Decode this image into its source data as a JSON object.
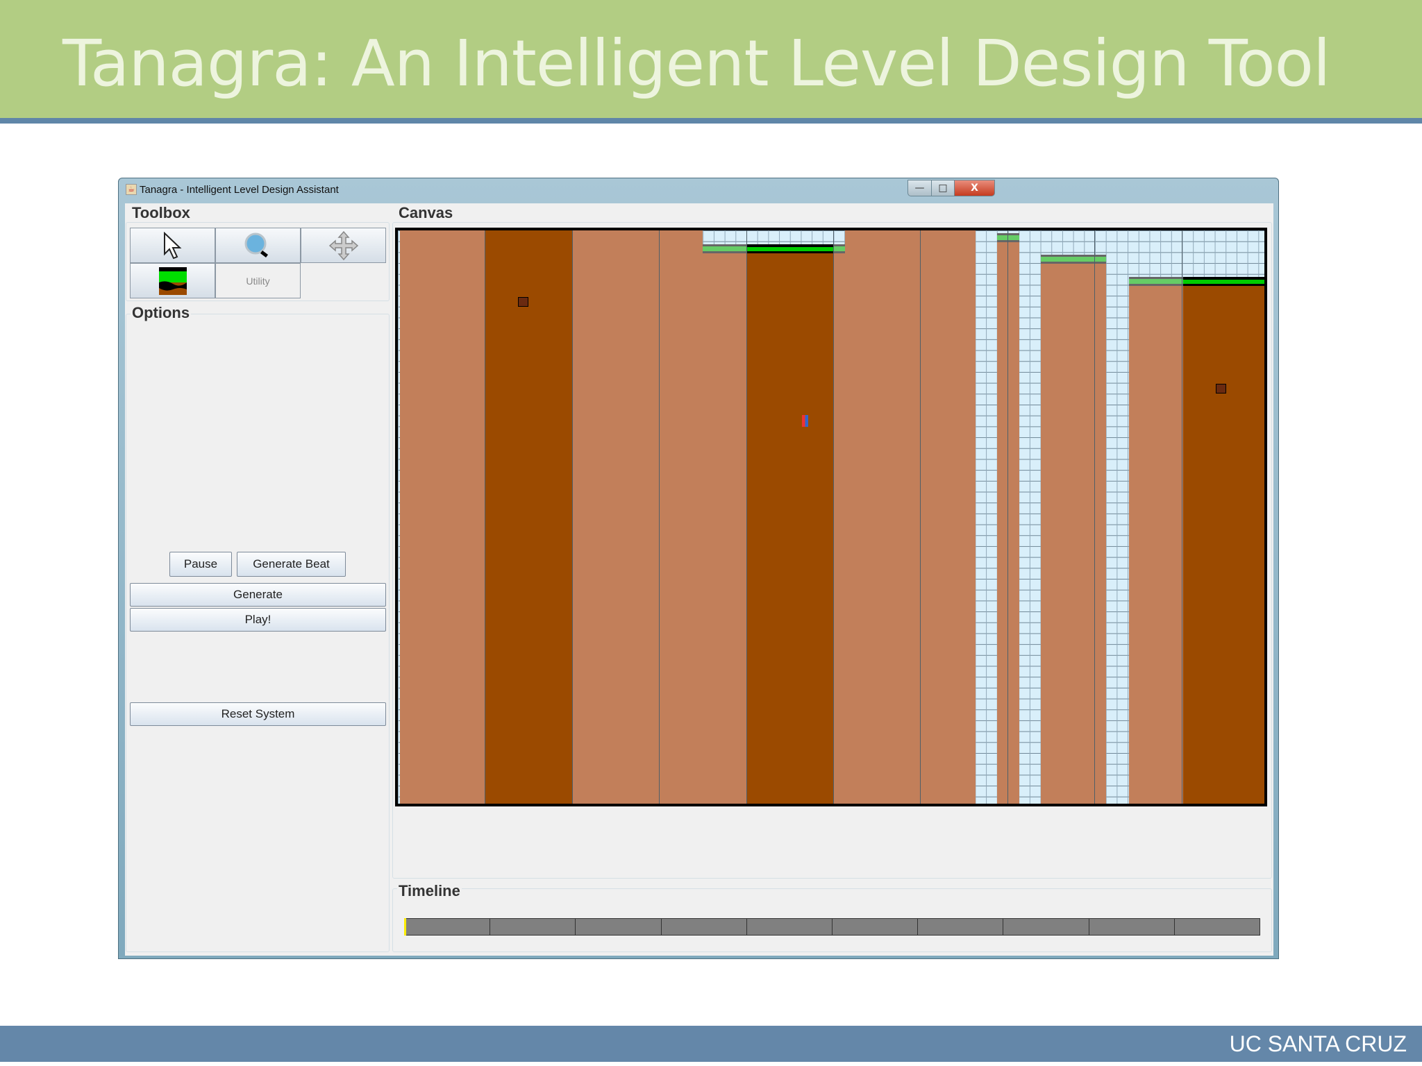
{
  "slide": {
    "title": "Tanagra: An Intelligent Level Design Tool",
    "footer": "UC SANTA CRUZ"
  },
  "window": {
    "title": "Tanagra - Intelligent Level Design Assistant",
    "minimize": "—",
    "maximize": "□",
    "close": "X"
  },
  "toolbox": {
    "label": "Toolbox",
    "tools": [
      {
        "name": "select",
        "icon": "arrow-cursor-icon"
      },
      {
        "name": "zoom",
        "icon": "magnifier-icon"
      },
      {
        "name": "pan",
        "icon": "move-arrows-icon"
      },
      {
        "name": "platform",
        "icon": "platform-tile-icon"
      }
    ],
    "utility_label": "Utility"
  },
  "options": {
    "label": "Options",
    "pause": "Pause",
    "generate_beat": "Generate Beat",
    "generate": "Generate",
    "play": "Play!",
    "reset": "Reset System"
  },
  "canvas": {
    "label": "Canvas"
  },
  "timeline": {
    "label": "Timeline",
    "segments": 10,
    "position": 0
  },
  "colors": {
    "sky": "#d9effa",
    "dirt": "#c27f5a",
    "dirt_selected": "#9b4a00",
    "grass": "#66cc66",
    "grass_selected": "#00cc00",
    "header": "#b2cd83",
    "footer": "#6487a9"
  }
}
